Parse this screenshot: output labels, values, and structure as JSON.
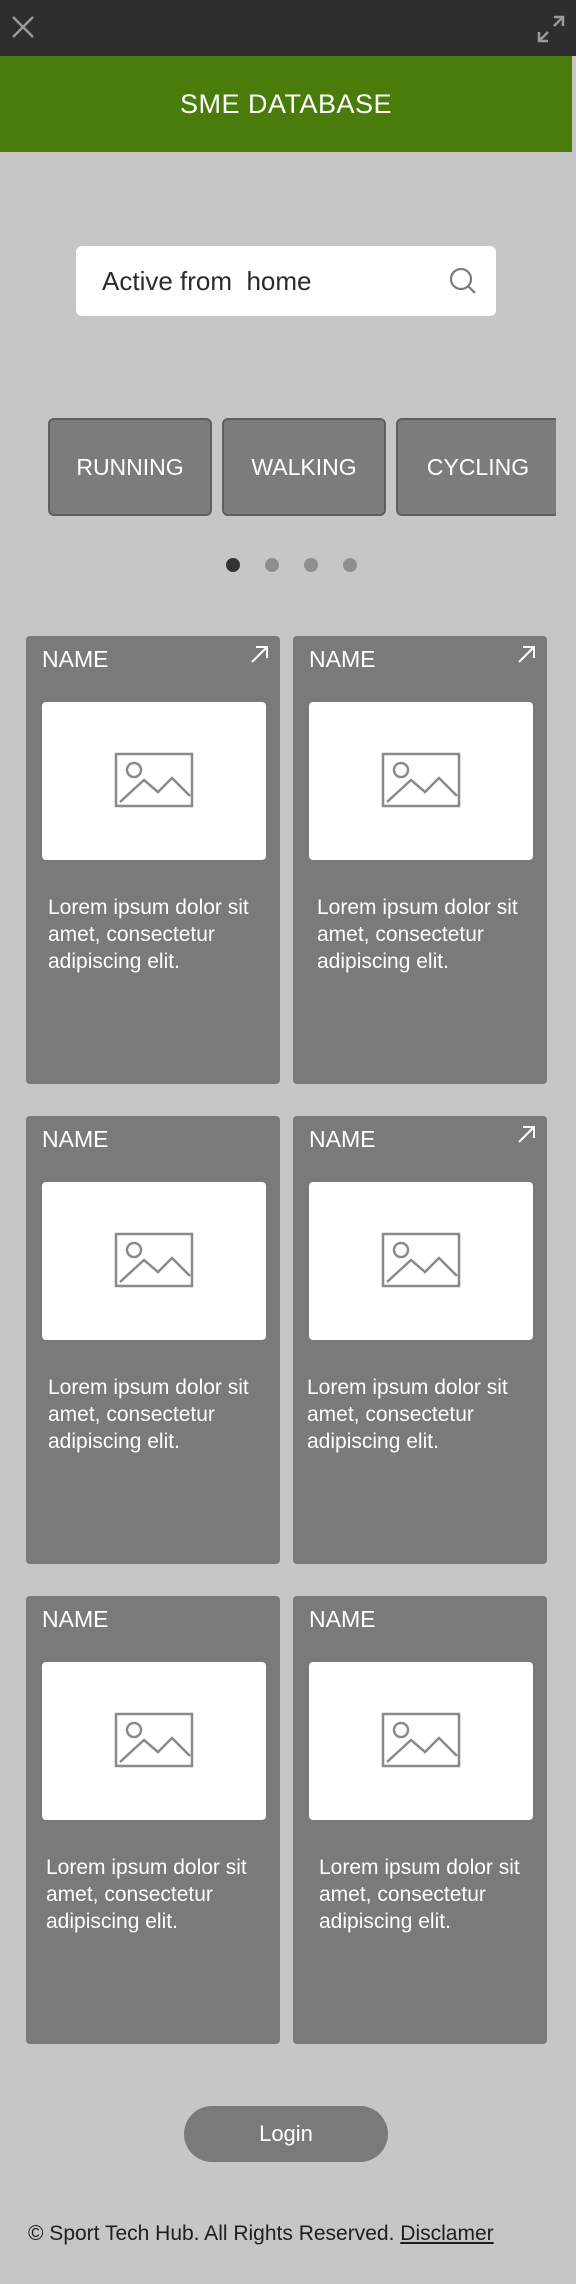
{
  "header": {
    "title": "SME DATABASE"
  },
  "search": {
    "value": "Active from  home"
  },
  "categories": [
    {
      "label": "RUNNING"
    },
    {
      "label": "WALKING"
    },
    {
      "label": "CYCLING"
    }
  ],
  "carousel": {
    "page_count": 4,
    "active_page": 1
  },
  "cards": [
    {
      "name": "NAME",
      "description": "Lorem ipsum dolor sit amet, consectetur adipiscing elit.",
      "has_link_icon": true
    },
    {
      "name": "NAME",
      "description": "Lorem ipsum dolor sit amet, consectetur adipiscing elit.",
      "has_link_icon": true
    },
    {
      "name": "NAME",
      "description": "Lorem ipsum dolor sit amet, consectetur adipiscing elit.",
      "has_link_icon": false
    },
    {
      "name": "NAME",
      "description": "Lorem ipsum dolor sit amet, consectetur adipiscing elit.",
      "has_link_icon": true
    },
    {
      "name": "NAME",
      "description": "Lorem ipsum dolor sit amet, consectetur adipiscing elit.",
      "has_link_icon": false
    },
    {
      "name": "NAME",
      "description": "Lorem ipsum dolor sit amet, consectetur adipiscing elit.",
      "has_link_icon": false
    }
  ],
  "login": {
    "label": "Login"
  },
  "footer": {
    "copyright": "© Sport Tech Hub. All Rights Reserved.",
    "disclaimer_label": "Disclamer"
  },
  "icons": {
    "close": "close-icon",
    "expand": "expand-icon",
    "search": "search-icon",
    "link": "arrow-up-right-icon",
    "image": "image-placeholder-icon"
  },
  "colors": {
    "header_bg": "#4a7c0c",
    "page_bg": "#c6c6c6",
    "card_bg": "#7a7a7a",
    "topbar_bg": "#2e2e2e"
  }
}
